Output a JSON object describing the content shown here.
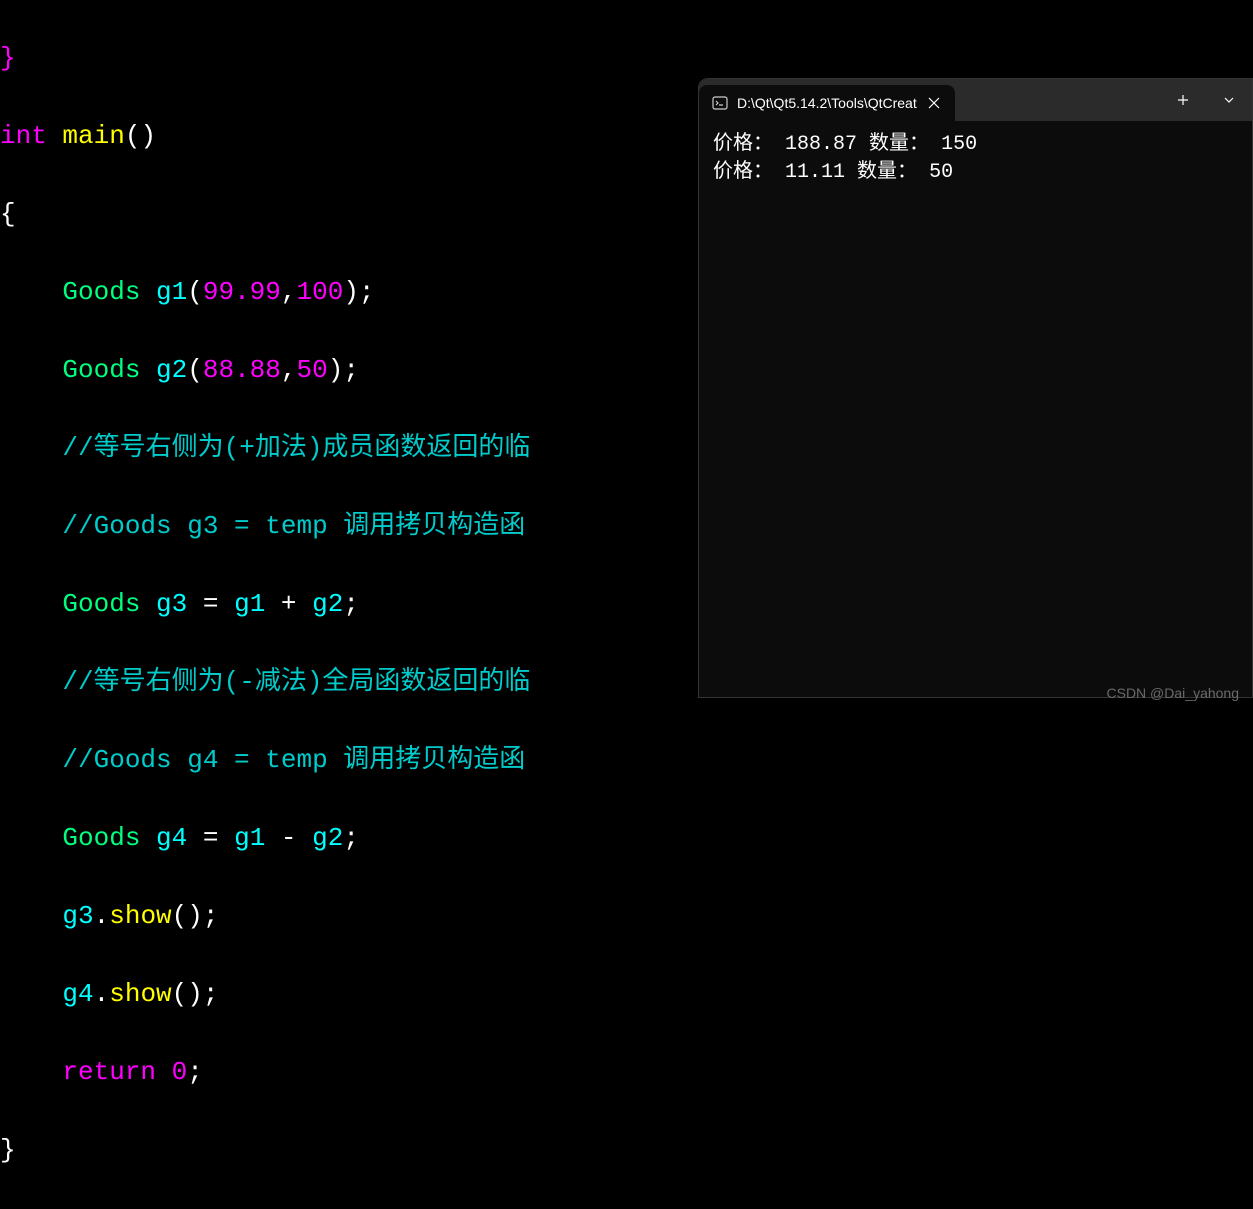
{
  "code": {
    "line0": "}",
    "int_kw": "int",
    "main_fn": "main",
    "parens": "()",
    "open_brace": "{",
    "indent": "    ",
    "goods_type": "Goods",
    "g1_var": "g1",
    "g1_paren_open": "(",
    "g1_num1": "99.99",
    "comma": ",",
    "g1_num2": "100",
    "g1_close": ");",
    "g2_var": "g2",
    "g2_num1": "88.88",
    "g2_num2": "50",
    "g2_close": ");",
    "comment1": "//等号右侧为(+加法)成员函数返回的临",
    "comment2": "//Goods g3 = temp 调用拷贝构造函",
    "g3_var": "g3",
    "eq": "=",
    "plus": "+",
    "semi": ";",
    "comment3": "//等号右侧为(-减法)全局函数返回的临",
    "comment4": "//Goods g4 = temp 调用拷贝构造函",
    "g4_var": "g4",
    "minus": "-",
    "g3_show": "g3",
    "dot": ".",
    "show_fn": "show",
    "call": "();",
    "g4_show": "g4",
    "return_kw": "return",
    "zero": "0",
    "close_brace": "}"
  },
  "terminal": {
    "tab_title": "D:\\Qt\\Qt5.14.2\\Tools\\QtCreat",
    "output_line1_label1": "价格：",
    "output_line1_val1": "188.87",
    "output_line1_label2": "数量：",
    "output_line1_val2": "150",
    "output_line2_label1": "价格：",
    "output_line2_val1": "11.11",
    "output_line2_label2": "数量：",
    "output_line2_val2": "50"
  },
  "watermark": "CSDN @Dai_yahong"
}
